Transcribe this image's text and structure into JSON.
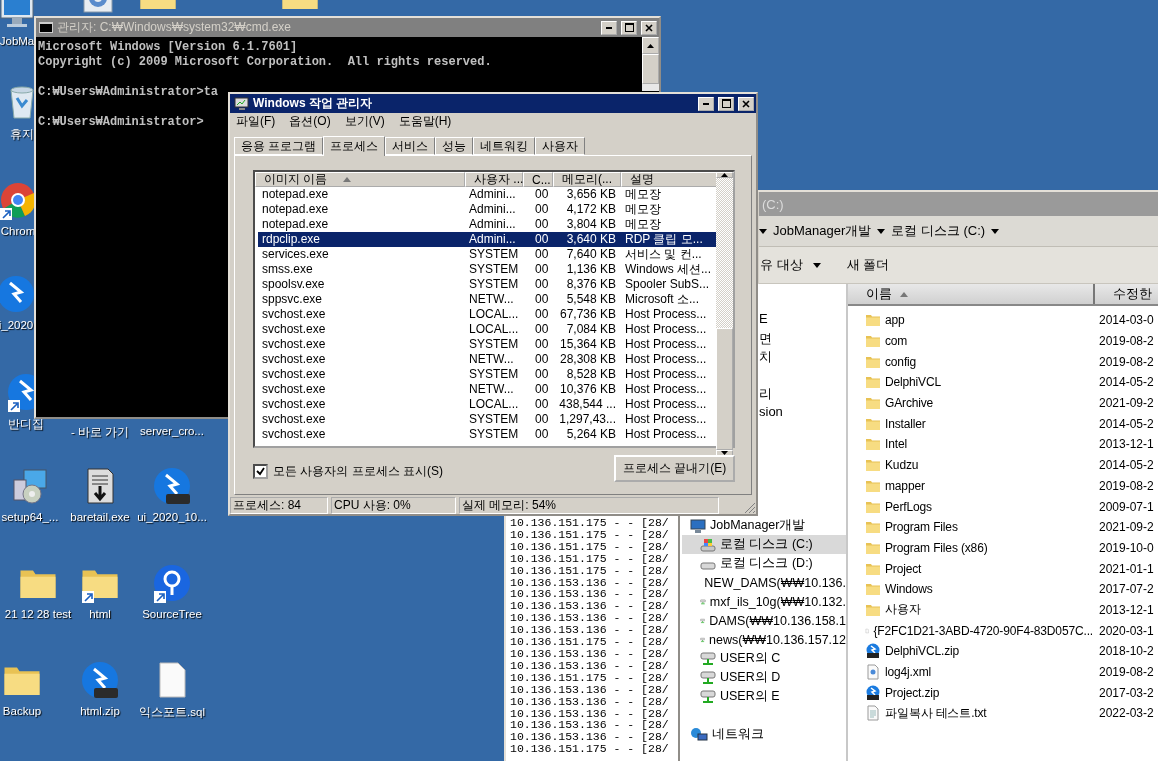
{
  "desktop": {
    "icons": [
      {
        "kind": "computer",
        "label": "JobMa",
        "shortcut": false
      },
      {
        "kind": "settings",
        "shortcut": false
      },
      {
        "kind": "folder",
        "shortcut": false
      },
      {
        "kind": "folder",
        "shortcut": false
      },
      {
        "kind": "recycle",
        "label": "휴지",
        "shortcut": false
      },
      {
        "kind": "chrome",
        "label": "Chrom",
        "shortcut": true
      },
      {
        "kind": "bandizip",
        "label": "i_2020",
        "shortcut": false
      },
      {
        "kind": "bandizip",
        "label": "반디집",
        "shortcut": true
      },
      {
        "kind": "hidden",
        "label": "- 바로 가기",
        "shortcut": false
      },
      {
        "kind": "hidden",
        "label": "server_cro...",
        "shortcut": false
      },
      {
        "kind": "setup",
        "label": "setup64_...",
        "shortcut": false
      },
      {
        "kind": "baretail",
        "label": "baretail.exe",
        "shortcut": false
      },
      {
        "kind": "zip",
        "label": "ui_2020_10...",
        "shortcut": false
      },
      {
        "kind": "folder",
        "label": "21 12 28 test",
        "shortcut": false
      },
      {
        "kind": "folder",
        "label": "html",
        "shortcut": true
      },
      {
        "kind": "sourcetree",
        "label": "SourceTree",
        "shortcut": true
      },
      {
        "kind": "folder",
        "label": "Backup",
        "shortcut": false
      },
      {
        "kind": "zip",
        "label": "html.zip",
        "shortcut": false
      },
      {
        "kind": "file",
        "label": "익스포트.sql",
        "shortcut": false
      }
    ]
  },
  "cmd_window": {
    "title": "관리자: C:₩Windows₩system32₩cmd.exe",
    "blocks": [
      [
        "Microsoft Windows [Version 6.1.7601]",
        "Copyright (c) 2009 Microsoft Corporation.  All rights reserved."
      ],
      [
        "C:₩Users₩Administrator>ta"
      ],
      [
        "C:₩Users₩Administrator>"
      ]
    ]
  },
  "log_window": {
    "lines": [
      "10.136.151.175 - - [28/",
      "10.136.151.175 - - [28/",
      "10.136.151.175 - - [28/",
      "10.136.151.175 - - [28/",
      "10.136.151.175 - - [28/",
      "10.136.153.136 - - [28/",
      "10.136.153.136 - - [28/",
      "10.136.153.136 - - [28/",
      "10.136.153.136 - - [28/",
      "10.136.153.136 - - [28/",
      "10.136.151.175 - - [28/",
      "10.136.153.136 - - [28/",
      "10.136.153.136 - - [28/",
      "10.136.151.175 - - [28/",
      "10.136.153.136 - - [28/",
      "10.136.153.136 - - [28/",
      "10.136.153.136 - - [28/",
      "10.136.153.136 - - [28/",
      "10.136.153.136 - - [28/",
      "10.136.151.175 - - [28/"
    ]
  },
  "explorer": {
    "title": "(C:)",
    "breadcrumb": [
      "JobManager개발",
      "로컬 디스크 (C:)"
    ],
    "toolbar": [
      {
        "label": "유 대상",
        "dropdown": true
      },
      {
        "label": "새 폴더",
        "dropdown": false
      }
    ],
    "nav_top": [
      {
        "label": "E",
        "gap_before": false
      },
      {
        "label": "면",
        "gap_before": false
      },
      {
        "label": "치",
        "gap_before": false
      },
      {
        "label": "리",
        "gap_before": true
      },
      {
        "label": "sion",
        "gap_before": false
      }
    ],
    "tree": [
      {
        "label": "JobManager개발",
        "kind": "computer",
        "selected": false,
        "children": [
          {
            "label": "로컬 디스크 (C:)",
            "kind": "system-drive",
            "selected": true
          },
          {
            "label": "로컬 디스크 (D:)",
            "kind": "drive",
            "selected": false
          },
          {
            "label": "NEW_DAMS(₩₩10.136.",
            "kind": "network-drive",
            "selected": false
          },
          {
            "label": "mxf_ils_10g(₩₩10.132.",
            "kind": "network-drive",
            "selected": false
          },
          {
            "label": "DAMS(₩₩10.136.158.1",
            "kind": "network-drive",
            "selected": false
          },
          {
            "label": "news(₩₩10.136.157.12",
            "kind": "network-drive",
            "selected": false
          },
          {
            "label": "USER의 C",
            "kind": "network-drive",
            "selected": false
          },
          {
            "label": "USER의 D",
            "kind": "network-drive",
            "selected": false
          },
          {
            "label": "USER의 E",
            "kind": "network-drive",
            "selected": false
          }
        ]
      },
      {
        "label": "네트워크",
        "kind": "network",
        "selected": false
      }
    ],
    "columns": [
      {
        "label": "이름",
        "sorted": true
      },
      {
        "label": "수정한",
        "sorted": false
      }
    ],
    "files": [
      {
        "name": "app",
        "kind": "folder",
        "date": "2014-03-0"
      },
      {
        "name": "com",
        "kind": "folder",
        "date": "2019-08-2"
      },
      {
        "name": "config",
        "kind": "folder",
        "date": "2019-08-2"
      },
      {
        "name": "DelphiVCL",
        "kind": "folder",
        "date": "2014-05-2"
      },
      {
        "name": "GArchive",
        "kind": "folder",
        "date": "2021-09-2"
      },
      {
        "name": "Installer",
        "kind": "folder",
        "date": "2014-05-2"
      },
      {
        "name": "Intel",
        "kind": "folder",
        "date": "2013-12-1"
      },
      {
        "name": "Kudzu",
        "kind": "folder",
        "date": "2014-05-2"
      },
      {
        "name": "mapper",
        "kind": "folder",
        "date": "2019-08-2"
      },
      {
        "name": "PerfLogs",
        "kind": "folder",
        "date": "2009-07-1"
      },
      {
        "name": "Program Files",
        "kind": "folder",
        "date": "2021-09-2"
      },
      {
        "name": "Program Files (x86)",
        "kind": "folder",
        "date": "2019-10-0"
      },
      {
        "name": "Project",
        "kind": "folder",
        "date": "2021-01-1"
      },
      {
        "name": "Windows",
        "kind": "folder",
        "date": "2017-07-2"
      },
      {
        "name": "사용자",
        "kind": "folder",
        "date": "2013-12-1"
      },
      {
        "name": "{F2FC1D21-3ABD-4720-90F4-83D057C...",
        "kind": "file",
        "date": "2020-03-1"
      },
      {
        "name": "DelphiVCL.zip",
        "kind": "zip",
        "date": "2018-10-2"
      },
      {
        "name": "log4j.xml",
        "kind": "xml",
        "date": "2019-08-2"
      },
      {
        "name": "Project.zip",
        "kind": "zip",
        "date": "2017-03-2"
      },
      {
        "name": "파일복사 테스트.txt",
        "kind": "text",
        "date": "2022-03-2"
      }
    ]
  },
  "task_manager": {
    "title": "Windows 작업 관리자",
    "menu": [
      "파일(F)",
      "옵션(O)",
      "보기(V)",
      "도움말(H)"
    ],
    "tabs": [
      {
        "label": "응용 프로그램",
        "selected": false
      },
      {
        "label": "프로세스",
        "selected": true
      },
      {
        "label": "서비스",
        "selected": false
      },
      {
        "label": "성능",
        "selected": false
      },
      {
        "label": "네트워킹",
        "selected": false
      },
      {
        "label": "사용자",
        "selected": false
      }
    ],
    "columns": [
      {
        "label": "이미지 이름",
        "sorted": true
      },
      {
        "label": "사용자 ...",
        "sorted": false
      },
      {
        "label": "C...",
        "sorted": false
      },
      {
        "label": "메모리(...",
        "sorted": false
      },
      {
        "label": "설명",
        "sorted": false
      }
    ],
    "rows": [
      {
        "name": "notepad.exe",
        "user": "Admini...",
        "cpu": "00",
        "memory": "3,656 KB",
        "description": "메모장",
        "selected": false
      },
      {
        "name": "notepad.exe",
        "user": "Admini...",
        "cpu": "00",
        "memory": "4,172 KB",
        "description": "메모장",
        "selected": false
      },
      {
        "name": "notepad.exe",
        "user": "Admini...",
        "cpu": "00",
        "memory": "3,804 KB",
        "description": "메모장",
        "selected": false
      },
      {
        "name": "rdpclip.exe",
        "user": "Admini...",
        "cpu": "00",
        "memory": "3,640 KB",
        "description": "RDP 클립 모...",
        "selected": true
      },
      {
        "name": "services.exe",
        "user": "SYSTEM",
        "cpu": "00",
        "memory": "7,640 KB",
        "description": "서비스 및 컨...",
        "selected": false
      },
      {
        "name": "smss.exe",
        "user": "SYSTEM",
        "cpu": "00",
        "memory": "1,136 KB",
        "description": "Windows 세션...",
        "selected": false
      },
      {
        "name": "spoolsv.exe",
        "user": "SYSTEM",
        "cpu": "00",
        "memory": "8,376 KB",
        "description": "Spooler SubS...",
        "selected": false
      },
      {
        "name": "sppsvc.exe",
        "user": "NETW...",
        "cpu": "00",
        "memory": "5,548 KB",
        "description": "Microsoft 소...",
        "selected": false
      },
      {
        "name": "svchost.exe",
        "user": "LOCAL...",
        "cpu": "00",
        "memory": "67,736 KB",
        "description": "Host Process...",
        "selected": false
      },
      {
        "name": "svchost.exe",
        "user": "LOCAL...",
        "cpu": "00",
        "memory": "7,084 KB",
        "description": "Host Process...",
        "selected": false
      },
      {
        "name": "svchost.exe",
        "user": "SYSTEM",
        "cpu": "00",
        "memory": "15,364 KB",
        "description": "Host Process...",
        "selected": false
      },
      {
        "name": "svchost.exe",
        "user": "NETW...",
        "cpu": "00",
        "memory": "28,308 KB",
        "description": "Host Process...",
        "selected": false
      },
      {
        "name": "svchost.exe",
        "user": "SYSTEM",
        "cpu": "00",
        "memory": "8,528 KB",
        "description": "Host Process...",
        "selected": false
      },
      {
        "name": "svchost.exe",
        "user": "NETW...",
        "cpu": "00",
        "memory": "10,376 KB",
        "description": "Host Process...",
        "selected": false
      },
      {
        "name": "svchost.exe",
        "user": "LOCAL...",
        "cpu": "00",
        "memory": "438,544 ...",
        "description": "Host Process...",
        "selected": false
      },
      {
        "name": "svchost.exe",
        "user": "SYSTEM",
        "cpu": "00",
        "memory": "1,297,43...",
        "description": "Host Process...",
        "selected": false
      },
      {
        "name": "svchost.exe",
        "user": "SYSTEM",
        "cpu": "00",
        "memory": "5,264 KB",
        "description": "Host Process...",
        "selected": false
      }
    ],
    "show_all_users": {
      "label": "모든 사용자의 프로세스 표시(S)",
      "checked": true
    },
    "end_button": "프로세스 끝내기(E)",
    "status": [
      "프로세스: 84",
      "CPU 사용: 0%",
      "실제 메모리: 54%"
    ]
  }
}
